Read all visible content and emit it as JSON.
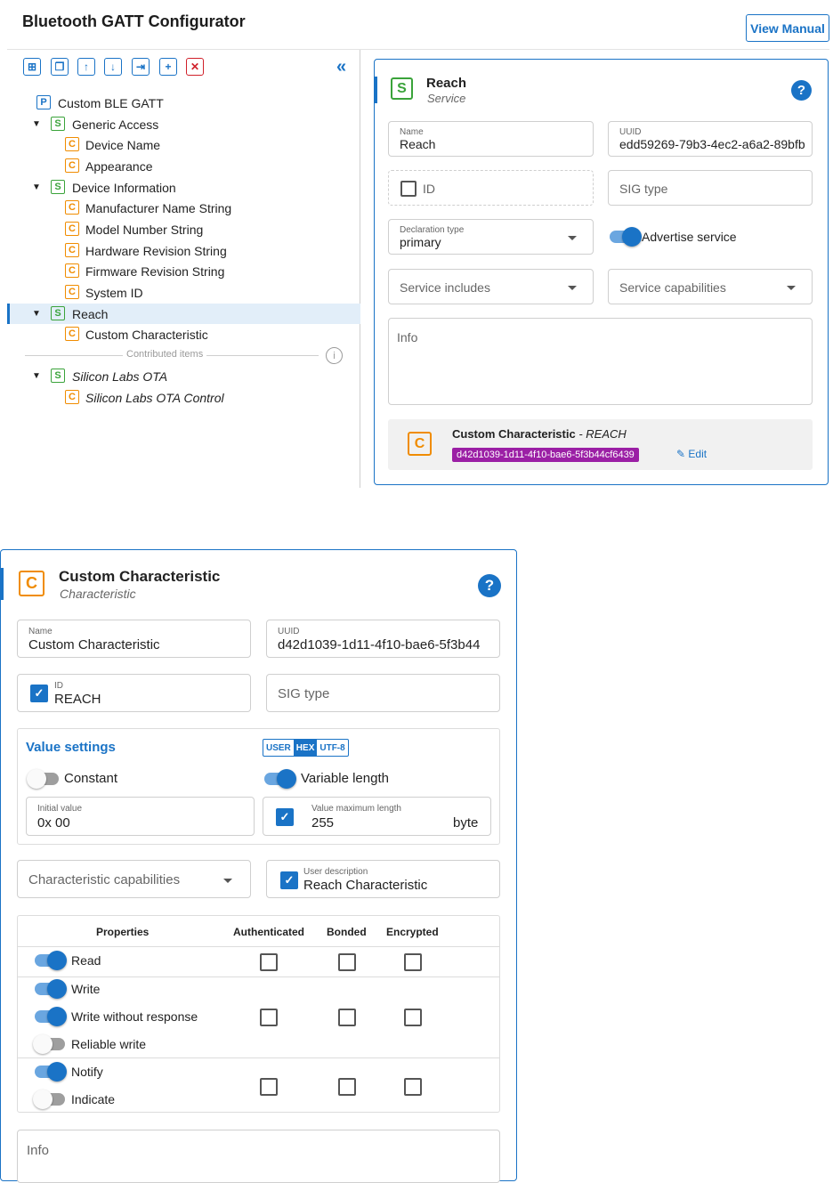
{
  "header": {
    "title": "Bluetooth GATT Configurator",
    "view_manual": "View Manual"
  },
  "toolbar": {
    "icons": [
      "import-icon",
      "duplicate-icon",
      "move-up-icon",
      "move-down-icon",
      "export-icon",
      "add-icon",
      "delete-icon",
      "collapse-panel-icon"
    ]
  },
  "tree": {
    "items": [
      {
        "label": "Custom BLE GATT",
        "kind": "P"
      },
      {
        "label": "Generic Access",
        "kind": "S"
      },
      {
        "label": "Device Name",
        "kind": "C"
      },
      {
        "label": "Appearance",
        "kind": "C"
      },
      {
        "label": "Device Information",
        "kind": "S"
      },
      {
        "label": "Manufacturer Name String",
        "kind": "C"
      },
      {
        "label": "Model Number String",
        "kind": "C"
      },
      {
        "label": "Hardware Revision String",
        "kind": "C"
      },
      {
        "label": "Firmware Revision String",
        "kind": "C"
      },
      {
        "label": "System ID",
        "kind": "C"
      },
      {
        "label": "Reach",
        "kind": "S"
      },
      {
        "label": "Custom Characteristic",
        "kind": "C"
      },
      {
        "label": "Silicon Labs OTA",
        "kind": "S"
      },
      {
        "label": "Silicon Labs OTA Control",
        "kind": "C"
      }
    ],
    "contributed_label": "Contributed items",
    "badge_letters": {
      "P": "P",
      "S": "S",
      "C": "C"
    }
  },
  "service": {
    "badge": "S",
    "title": "Reach",
    "subtitle": "Service",
    "help": "?",
    "name_label": "Name",
    "name_value": "Reach",
    "uuid_label": "UUID",
    "uuid_value": "edd59269-79b3-4ec2-a6a2-89bfb",
    "id_placeholder": "ID",
    "sig_placeholder": "SIG type",
    "declaration_label": "Declaration type",
    "declaration_value": "primary",
    "advertise_label": "Advertise service",
    "includes_placeholder": "Service includes",
    "capabilities_placeholder": "Service capabilities",
    "info_placeholder": "Info",
    "char_name": "Custom Characteristic",
    "char_id": " - REACH",
    "char_uuid": "d42d1039-1d11-4f10-bae6-5f3b44cf6439",
    "edit_label": "Edit"
  },
  "characteristic": {
    "badge": "C",
    "title": "Custom Characteristic",
    "subtitle": "Characteristic",
    "help": "?",
    "name_label": "Name",
    "name_value": "Custom Characteristic",
    "uuid_label": "UUID",
    "uuid_value": "d42d1039-1d11-4f10-bae6-5f3b44",
    "id_label": "ID",
    "id_value": "REACH",
    "sig_placeholder": "SIG type",
    "value_settings_title": "Value settings",
    "format_options": [
      "USER",
      "HEX",
      "UTF-8"
    ],
    "format_selected": "HEX",
    "constant_label": "Constant",
    "variable_length_label": "Variable length",
    "initial_value_label": "Initial value",
    "initial_value": "0x 00",
    "max_length_label": "Value maximum length",
    "max_length_value": "255",
    "max_length_unit": "byte",
    "capabilities_placeholder": "Characteristic capabilities",
    "user_desc_label": "User description",
    "user_desc_value": "Reach Characteristic",
    "table_headers": [
      "Properties",
      "Authenticated",
      "Bonded",
      "Encrypted"
    ],
    "properties": [
      {
        "label": "Read",
        "on": true
      },
      {
        "label": "Write",
        "on": true
      },
      {
        "label": "Write without response",
        "on": true
      },
      {
        "label": "Reliable write",
        "on": false
      },
      {
        "label": "Notify",
        "on": true
      },
      {
        "label": "Indicate",
        "on": false
      }
    ],
    "info_placeholder": "Info"
  },
  "colors": {
    "accent": "#1a73c6",
    "service_green": "#3aa33a",
    "characteristic_orange": "#f08c00",
    "delete_red": "#d0202a",
    "uuid_chip": "#9b1fa5"
  }
}
